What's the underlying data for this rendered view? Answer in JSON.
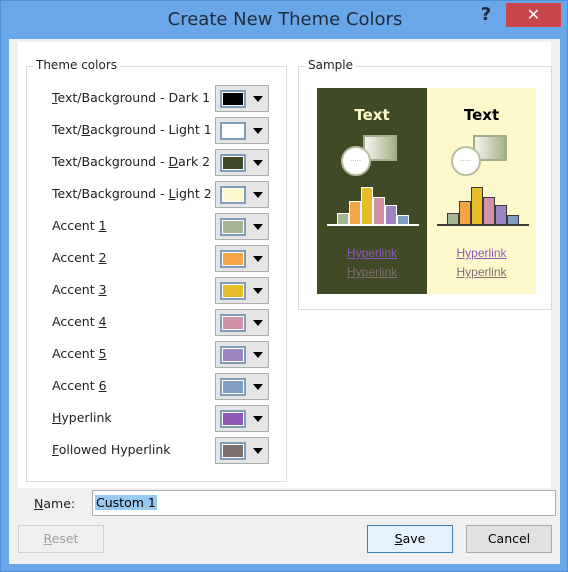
{
  "window": {
    "title": "Create New Theme Colors",
    "help_label": "?",
    "close_label": "✕"
  },
  "theme_colors": {
    "legend": "Theme colors",
    "rows": [
      {
        "label_pre": "",
        "label_ul": "T",
        "label_post": "ext/Background - Dark 1",
        "color": "#000000"
      },
      {
        "label_pre": "Text/",
        "label_ul": "B",
        "label_post": "ackground - Light 1",
        "color": "#ffffff"
      },
      {
        "label_pre": "Text/Background - ",
        "label_ul": "D",
        "label_post": "ark 2",
        "color": "#414a27"
      },
      {
        "label_pre": "Text/Background - ",
        "label_ul": "L",
        "label_post": "ight 2",
        "color": "#fdf9cd"
      },
      {
        "label_pre": "Accent ",
        "label_ul": "1",
        "label_post": "",
        "color": "#a5b592"
      },
      {
        "label_pre": "Accent ",
        "label_ul": "2",
        "label_post": "",
        "color": "#f3a447"
      },
      {
        "label_pre": "Accent ",
        "label_ul": "3",
        "label_post": "",
        "color": "#e7bc29"
      },
      {
        "label_pre": "Accent ",
        "label_ul": "4",
        "label_post": "",
        "color": "#d092a7"
      },
      {
        "label_pre": "Accent ",
        "label_ul": "5",
        "label_post": "",
        "color": "#9c85c0"
      },
      {
        "label_pre": "Accent ",
        "label_ul": "6",
        "label_post": "",
        "color": "#809ec2"
      },
      {
        "label_pre": "",
        "label_ul": "H",
        "label_post": "yperlink",
        "color": "#8e58b6"
      },
      {
        "label_pre": "",
        "label_ul": "F",
        "label_post": "ollowed Hyperlink",
        "color": "#7f6f6f"
      }
    ]
  },
  "sample": {
    "legend": "Sample",
    "dark_text": "Text",
    "light_text": "Text",
    "circle_text": "·····",
    "hyperlink": "Hyperlink",
    "followed_hyperlink": "Hyperlink",
    "dark_bg": "#414a27",
    "light_bg": "#fdf9cd",
    "bar_levels": [
      0.3,
      0.6,
      0.95,
      0.7,
      0.5,
      0.25
    ]
  },
  "name": {
    "label_ul": "N",
    "label_post": "ame:",
    "value": "Custom 1"
  },
  "buttons": {
    "reset_ul": "R",
    "reset_post": "eset",
    "save_ul": "S",
    "save_post": "ave",
    "cancel": "Cancel"
  }
}
